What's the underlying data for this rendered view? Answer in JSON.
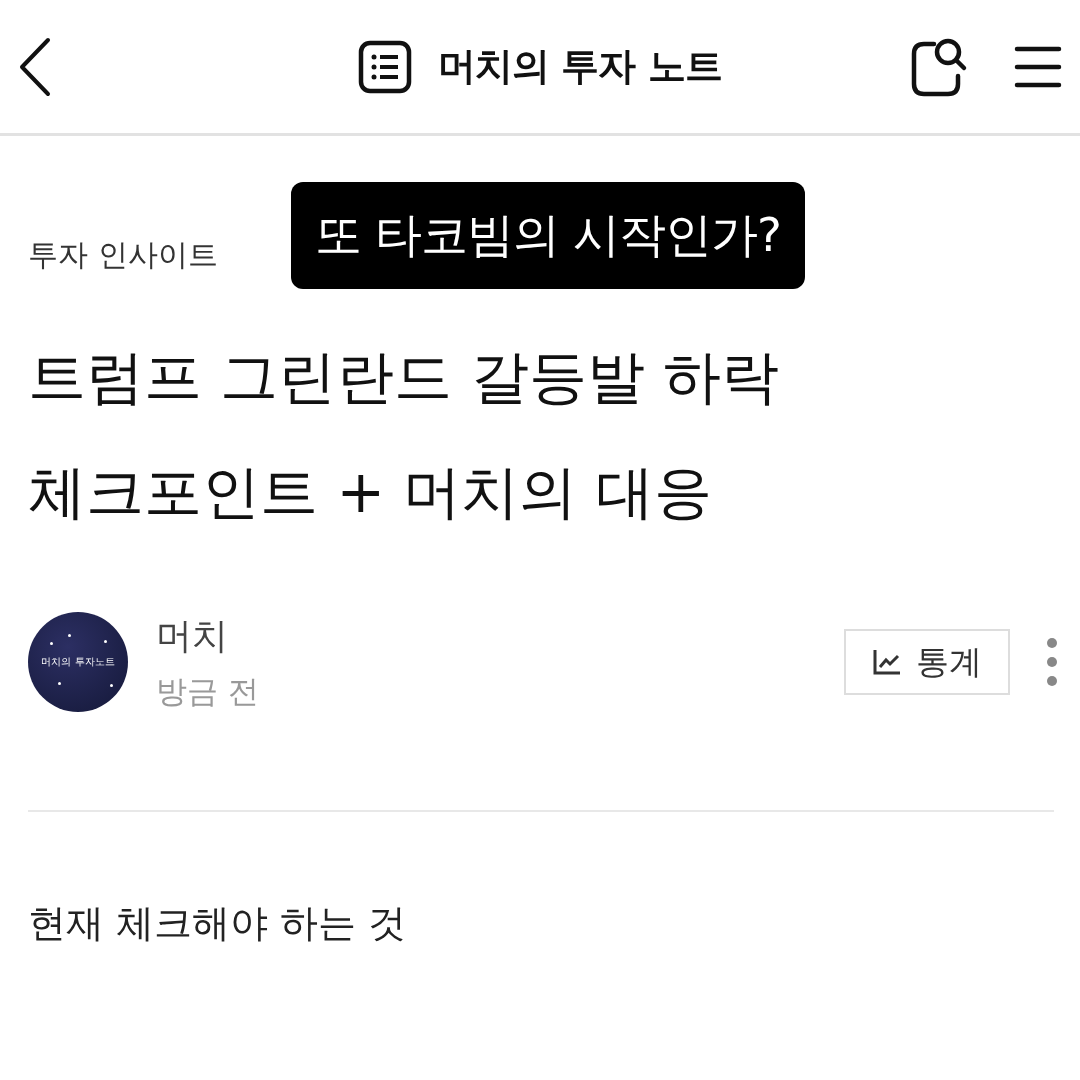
{
  "header": {
    "title": "머치의 투자 노트"
  },
  "caption": "또 타코빔의 시작인가?",
  "post": {
    "category": "투자 인사이트",
    "title_lines": [
      "트럼프 그린란드 갈등발 하락",
      "체크포인트 + 머치의 대응"
    ],
    "author": {
      "name": "머치",
      "time": "방금 전",
      "avatar_text": "머치의 투자노트"
    },
    "stats_button": "통계",
    "body": [
      "현재 체크해야 하는 것"
    ]
  }
}
